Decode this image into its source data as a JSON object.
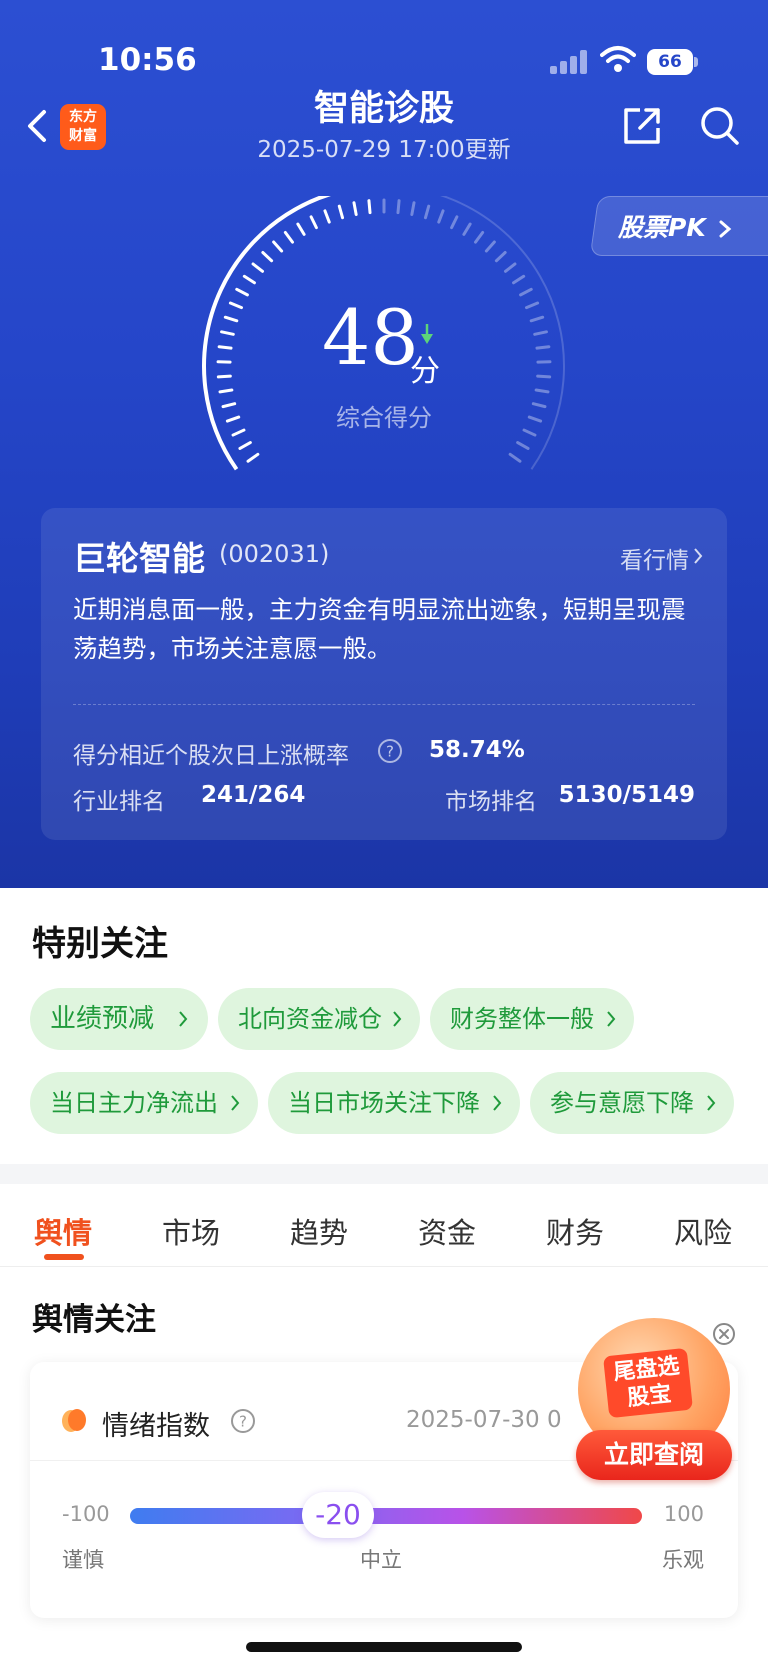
{
  "status_bar": {
    "time": "10:56",
    "battery": "66"
  },
  "header": {
    "logo_line1": "东方",
    "logo_line2": "财富",
    "title": "智能诊股",
    "updated": "2025-07-29 17:00更新",
    "pk_label": "股票PK"
  },
  "score": {
    "value": "48",
    "unit": "分",
    "caption": "综合得分",
    "fraction": 0.48
  },
  "summary": {
    "stock_name": "巨轮智能",
    "stock_code": "(002031)",
    "quote_link": "看行情",
    "text": "近期消息面一般，主力资金有明显流出迹象，短期呈现震荡趋势，市场关注意愿一般。",
    "prob_label": "得分相近个股次日上涨概率",
    "prob_value": "58.74%",
    "industry_label": "行业排名",
    "industry_value": "241/264",
    "market_label": "市场排名",
    "market_value": "5130/5149"
  },
  "focus": {
    "title": "特别关注",
    "tags": [
      "业绩预减",
      "北向资金减仓",
      "财务整体一般",
      "当日主力净流出",
      "当日市场关注下降",
      "参与意愿下降"
    ]
  },
  "tabs": [
    "舆情",
    "市场",
    "趋势",
    "资金",
    "财务",
    "风险"
  ],
  "sentiment": {
    "title": "舆情关注",
    "mood_label": "情绪指数",
    "date": "2025-07-30 0",
    "scale_min": "-100",
    "scale_max": "100",
    "value": "-20",
    "left_label": "谨慎",
    "mid_label": "中立",
    "right_label": "乐观"
  },
  "promo": {
    "text": "尾盘选股宝",
    "button": "立即查阅"
  },
  "colors": {
    "accent": "#f0511e",
    "hero": "#2546c9",
    "tag_text": "#1f9a3b",
    "tag_bg": "#dff5de"
  }
}
